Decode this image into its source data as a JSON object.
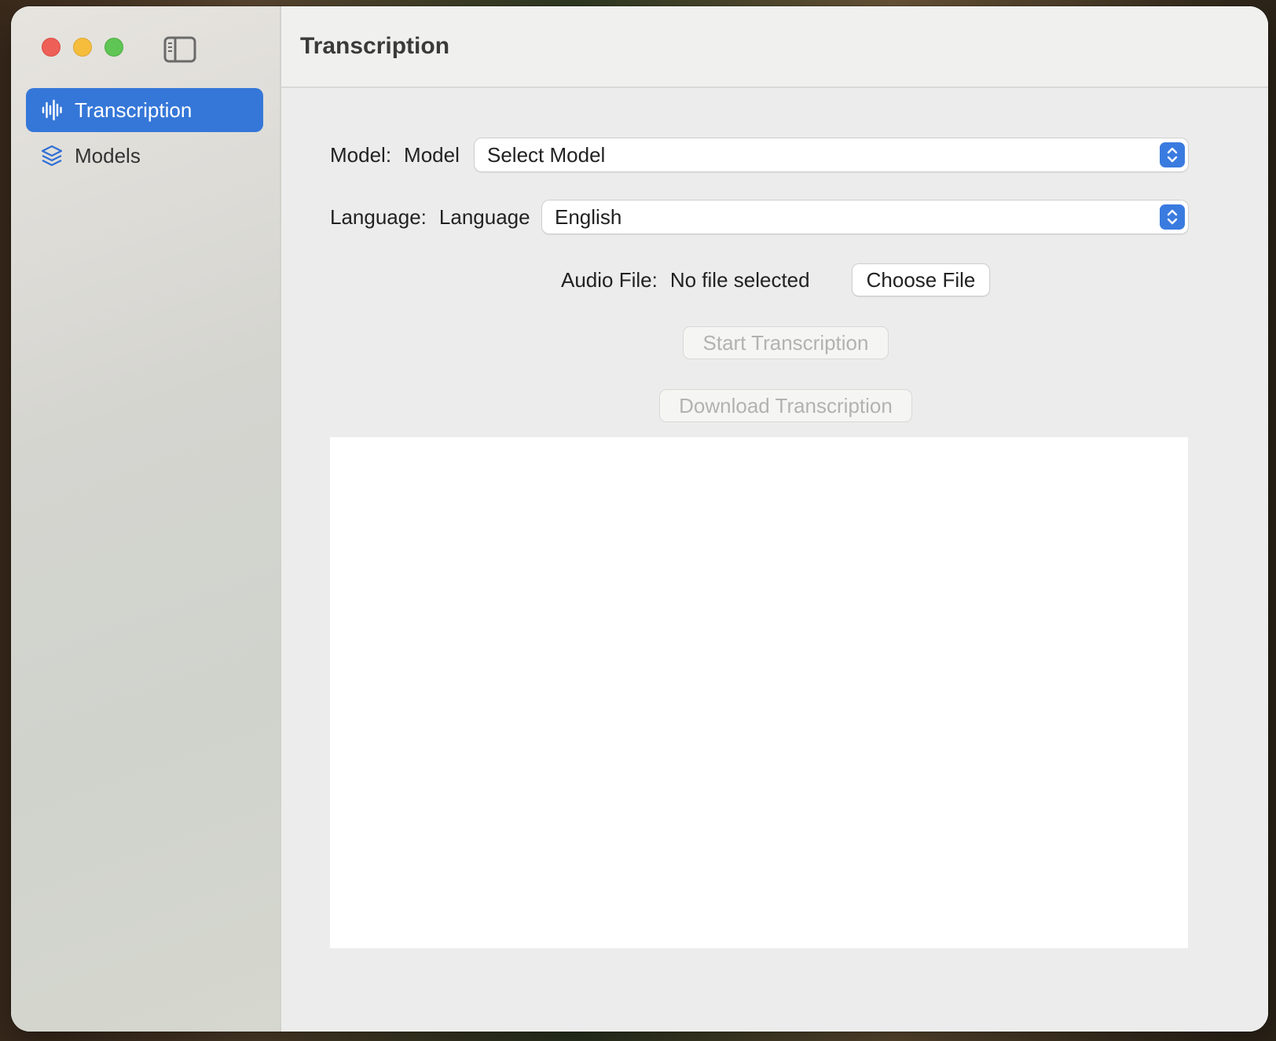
{
  "window": {
    "title": "Transcription"
  },
  "sidebar": {
    "items": [
      {
        "label": "Transcription",
        "icon": "waveform-icon",
        "active": true
      },
      {
        "label": "Models",
        "icon": "layers-icon",
        "active": false
      }
    ]
  },
  "form": {
    "model_label": "Model:",
    "model_inner_label": "Model",
    "model_value": "Select Model",
    "language_label": "Language:",
    "language_inner_label": "Language",
    "language_value": "English",
    "audio_label": "Audio File:",
    "audio_value": "No file selected",
    "choose_file_label": "Choose File",
    "start_label": "Start Transcription",
    "download_label": "Download Transcription"
  },
  "transcript_text": "",
  "colors": {
    "accent": "#3577d8",
    "close": "#ee5f57",
    "minimize": "#f6bd3d",
    "zoom": "#5fc554"
  }
}
